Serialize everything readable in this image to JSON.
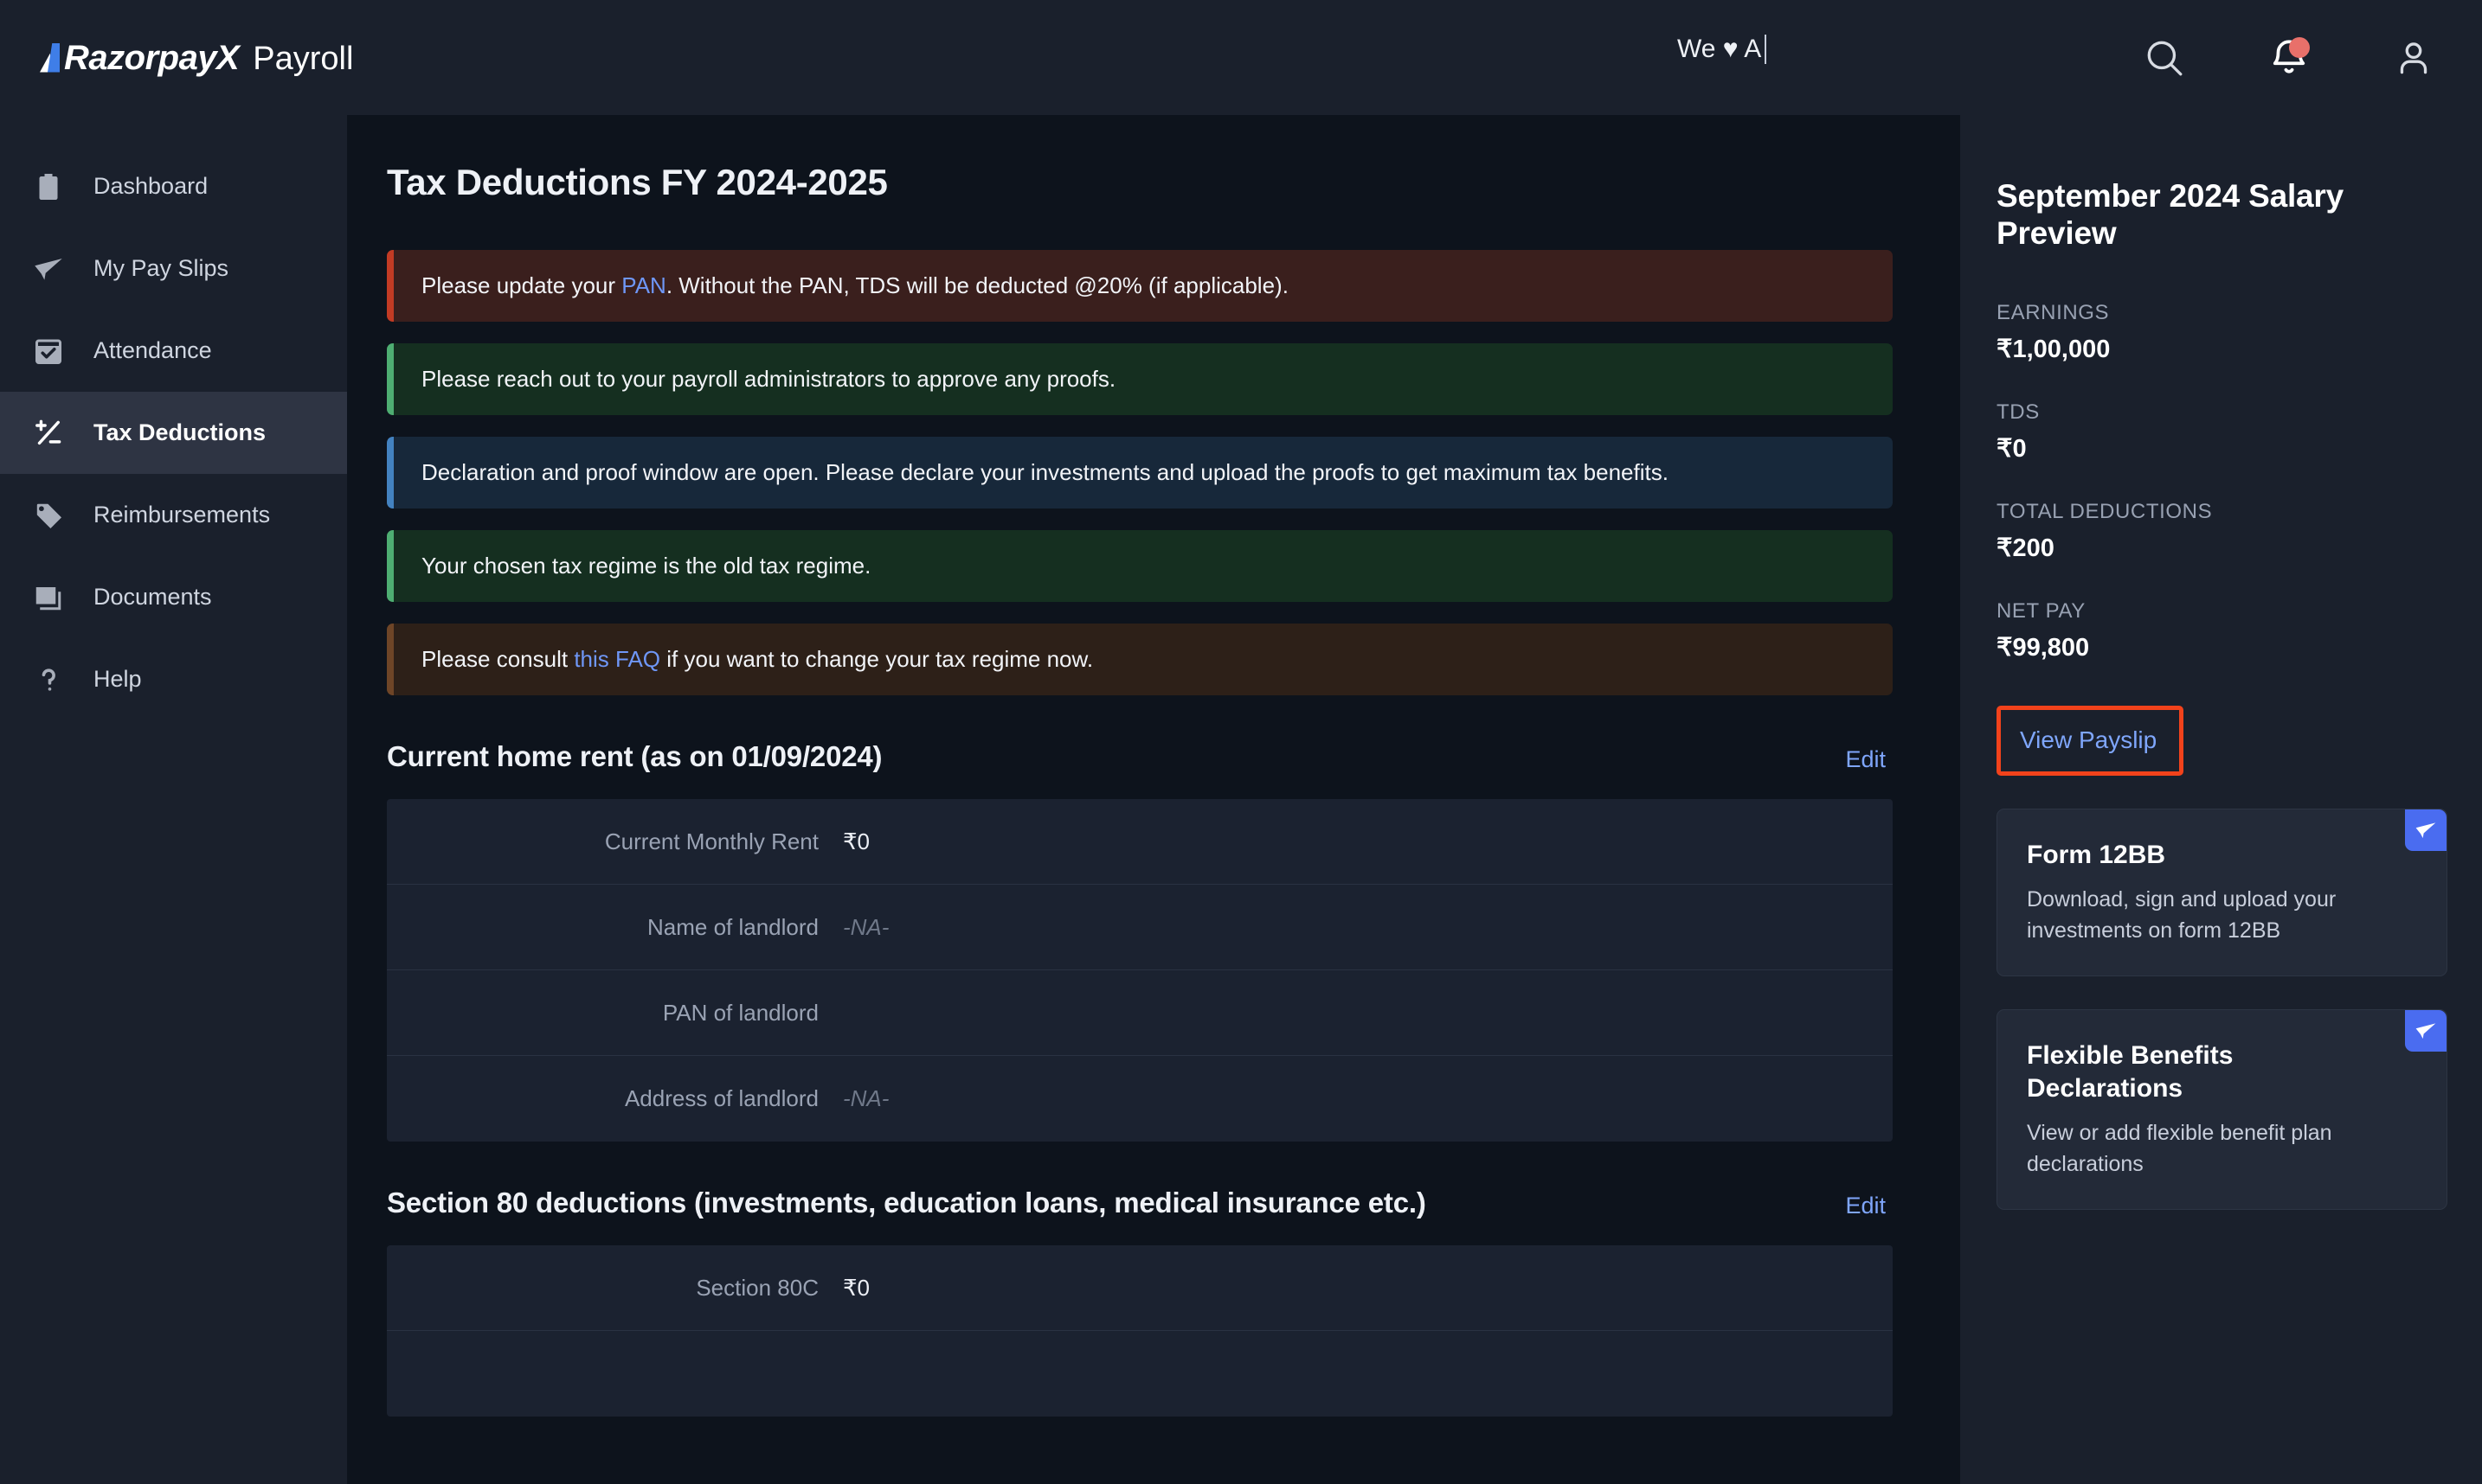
{
  "header": {
    "brand_name": "RazorpayX",
    "brand_suffix": "Payroll",
    "center_text": "We ♥ A",
    "search_icon": "search-icon",
    "bell_icon": "notification-bell-icon",
    "account_icon": "user-account-icon"
  },
  "sidebar": {
    "items": [
      {
        "label": "Dashboard",
        "icon": "clipboard-icon",
        "active": false
      },
      {
        "label": "My Pay Slips",
        "icon": "paper-plane-icon",
        "active": false
      },
      {
        "label": "Attendance",
        "icon": "calendar-check-icon",
        "active": false
      },
      {
        "label": "Tax Deductions",
        "icon": "plus-minus-icon",
        "active": true
      },
      {
        "label": "Reimbursements",
        "icon": "tag-icon",
        "active": false
      },
      {
        "label": "Documents",
        "icon": "documents-icon",
        "active": false
      },
      {
        "label": "Help",
        "icon": "question-mark-icon",
        "active": false
      }
    ]
  },
  "main": {
    "page_title": "Tax Deductions FY 2024-2025",
    "alerts": [
      {
        "type": "red",
        "pre": "Please update your ",
        "link": "PAN",
        "post": ". Without the PAN, TDS will be deducted @20% (if applicable)."
      },
      {
        "type": "green",
        "pre": "Please reach out to your payroll administrators to approve any proofs.",
        "link": "",
        "post": ""
      },
      {
        "type": "blue",
        "pre": "Declaration and proof window are open. Please declare your investments and upload the proofs to get maximum tax benefits.",
        "link": "",
        "post": ""
      },
      {
        "type": "green",
        "pre": "Your chosen tax regime is the old tax regime.",
        "link": "",
        "post": ""
      },
      {
        "type": "brown",
        "pre": "Please consult ",
        "link": "this FAQ",
        "post": " if you want to change your tax regime now."
      }
    ],
    "rent_section": {
      "title": "Current home rent (as on 01/09/2024)",
      "edit_label": "Edit",
      "rows": [
        {
          "label": "Current Monthly Rent",
          "value": "₹0",
          "style": "normal"
        },
        {
          "label": "Name of landlord",
          "value": "-NA-",
          "style": "na"
        },
        {
          "label": "PAN of landlord",
          "value": "",
          "style": "empty"
        },
        {
          "label": "Address of landlord",
          "value": "-NA-",
          "style": "na"
        }
      ]
    },
    "section80": {
      "title": "Section 80 deductions (investments, education loans, medical insurance etc.)",
      "edit_label": "Edit",
      "rows": [
        {
          "label": "Section 80C",
          "value": "₹0",
          "style": "normal"
        },
        {
          "label": "",
          "value": "",
          "style": "empty"
        }
      ]
    }
  },
  "right_panel": {
    "title": "September 2024 Salary Preview",
    "stats": [
      {
        "label": "EARNINGS",
        "value": "₹1,00,000"
      },
      {
        "label": "TDS",
        "value": "₹0"
      },
      {
        "label": "TOTAL DEDUCTIONS",
        "value": "₹200"
      },
      {
        "label": "NET PAY",
        "value": "₹99,800"
      }
    ],
    "payslip_link": "View Payslip",
    "highlight_color": "#f2421b",
    "cards": [
      {
        "title": "Form 12BB",
        "desc": "Download, sign and upload your investments on form 12BB",
        "badge_icon": "paper-plane-icon"
      },
      {
        "title": "Flexible Benefits Declarations",
        "desc": "View or add flexible benefit plan declarations",
        "badge_icon": "paper-plane-icon"
      }
    ]
  }
}
